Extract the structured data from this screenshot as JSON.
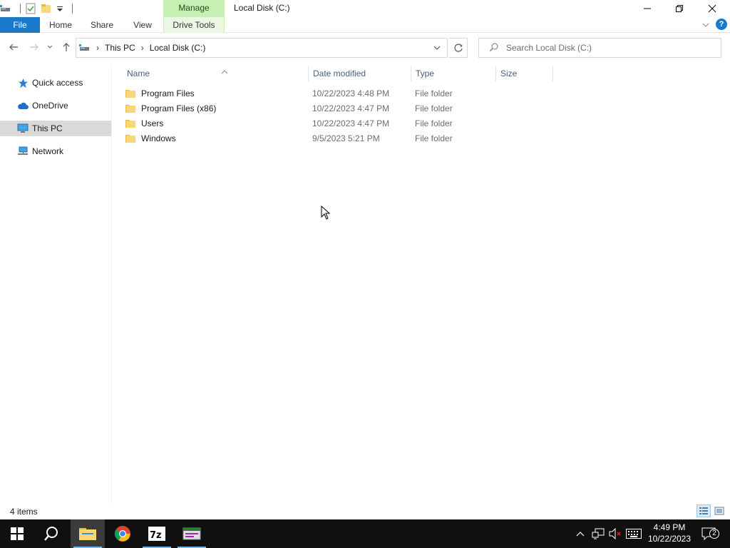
{
  "window": {
    "title": "Local Disk (C:)",
    "contextual_tab": "Manage"
  },
  "ribbon": {
    "tabs": [
      {
        "label": "File"
      },
      {
        "label": "Home"
      },
      {
        "label": "Share"
      },
      {
        "label": "View"
      },
      {
        "label": "Drive Tools"
      }
    ]
  },
  "address": {
    "breadcrumb": [
      "This PC",
      "Local Disk (C:)"
    ],
    "search_placeholder": "Search Local Disk (C:)"
  },
  "nav": {
    "items": [
      {
        "label": "Quick access",
        "icon": "star-icon"
      },
      {
        "label": "OneDrive",
        "icon": "cloud-icon"
      },
      {
        "label": "This PC",
        "icon": "computer-icon",
        "selected": true
      },
      {
        "label": "Network",
        "icon": "network-icon"
      }
    ]
  },
  "columns": {
    "name": "Name",
    "date": "Date modified",
    "type": "Type",
    "size": "Size"
  },
  "files": [
    {
      "name": "Program Files",
      "date": "10/22/2023 4:48 PM",
      "type": "File folder"
    },
    {
      "name": "Program Files (x86)",
      "date": "10/22/2023 4:47 PM",
      "type": "File folder"
    },
    {
      "name": "Users",
      "date": "10/22/2023 4:47 PM",
      "type": "File folder"
    },
    {
      "name": "Windows",
      "date": "9/5/2023 5:21 PM",
      "type": "File folder"
    }
  ],
  "status": {
    "count": "4 items"
  },
  "taskbar": {
    "clock_time": "4:49 PM",
    "clock_date": "10/22/2023",
    "notification_count": "2"
  },
  "colors": {
    "file_tab": "#1979ca",
    "manage_tab": "#c6efb3",
    "folder": "#f8d775",
    "taskbar": "#101010",
    "accent": "#76b9ed"
  }
}
